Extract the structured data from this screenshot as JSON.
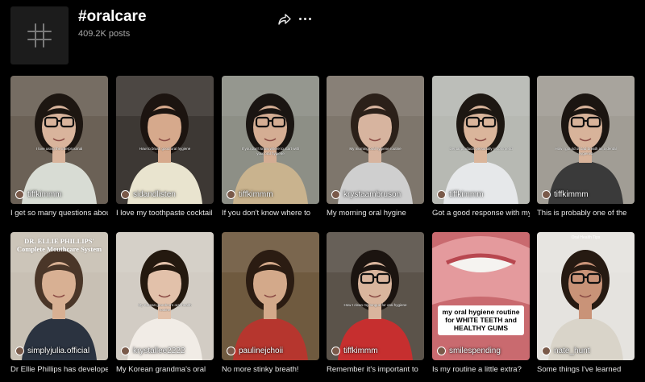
{
  "header": {
    "tag_icon": "hashtag-icon",
    "title": "#oraldcare",
    "posts": "409.2K posts",
    "share_icon": "share-icon",
    "more_icon": "more-dots-icon"
  },
  "posts": [
    {
      "username": "tiffkimmm",
      "caption": "I get so many questions about",
      "overlay": "I love using the\ninterproximal",
      "bg": "#6b6156",
      "skin": "#d9b49c",
      "hair": "#1d1611",
      "shirt": "#d8dcd4",
      "glasses": true
    },
    {
      "username": "sidandlisten",
      "caption": "I love my toothpaste cocktail",
      "overlay": "How to brush good\noral hygiene",
      "bg": "#3d3834",
      "skin": "#d6a98c",
      "hair": "#1c1410",
      "shirt": "#e9e4cf",
      "glasses": false
    },
    {
      "username": "tiffkimmm",
      "caption": "If you don't know where to",
      "overlay": "If you don't know where to\nstart with your oral hygiene",
      "bg": "#8d8f86",
      "skin": "#d4ad93",
      "hair": "#1a1512",
      "shirt": "#c9b38e",
      "glasses": true
    },
    {
      "username": "krystaambruson",
      "caption": "My morning oral hygine",
      "overlay": "My morning oral hygiene\nroutine",
      "bg": "#7e766c",
      "skin": "#d7b49f",
      "hair": "#2b2019",
      "shirt": "#cfcfcf",
      "glasses": false
    },
    {
      "username": "tiffkimmm",
      "caption": "Got a good response with my",
      "overlay": "Dental products\npersonally recommend",
      "bg": "#b7b9b3",
      "skin": "#dab59b",
      "hair": "#1d1712",
      "shirt": "#e6e8ea",
      "glasses": true
    },
    {
      "username": "tiffkimmm",
      "caption": "This is probably one of the",
      "overlay": "How I got rid of bad breath\nas a dental hygienist",
      "bg": "#a19d95",
      "skin": "#d8b39a",
      "hair": "#1b1511",
      "shirt": "#3a3a3a",
      "glasses": true
    },
    {
      "username": "simplyjulia.official",
      "caption": "Dr Ellie Phillips has developed",
      "overlay": "DR. ELLIE PHILLIPS'\nComplete Mouthcare System",
      "bg": "#c8c0b4",
      "skin": "#d8b093",
      "hair": "#4a3628",
      "shirt": "#2b3340",
      "glasses": false
    },
    {
      "username": "krystallee2222",
      "caption": "My Korean grandma's oral",
      "overlay": "My Korean grandma's oral\nhealth routine",
      "bg": "#d2ccc4",
      "skin": "#e2c1aa",
      "hair": "#24190f",
      "shirt": "#f1ece6",
      "glasses": false
    },
    {
      "username": "paulinejchoii",
      "caption": "No more stinky breath!",
      "overlay": "",
      "bg": "#6f5a3f",
      "skin": "#d3a98a",
      "hair": "#2b1c12",
      "shirt": "#b6362e",
      "glasses": false
    },
    {
      "username": "tiffkimmm",
      "caption": "Remember it's important to",
      "overlay": "How I clean my tongue\nfor oral hygiene",
      "bg": "#5b534a",
      "skin": "#d9b59d",
      "hair": "#1b1410",
      "shirt": "#c62f2f",
      "glasses": true
    },
    {
      "username": "smilespending",
      "caption": "Is my routine a little extra?",
      "overlay": "my oral hygiene routine for WHITE TEETH and HEALTHY GUMS",
      "bg": "#c96a6f",
      "skin": "#e09498",
      "hair": "#f0dede",
      "shirt": "#f4f4f4",
      "glasses": false
    },
    {
      "username": "nate_hunt",
      "caption": "Some things I've learned",
      "overlay": "Oral Health Tips",
      "bg": "#e5e3df",
      "skin": "#c99378",
      "hair": "#261a12",
      "shirt": "#d9d4c9",
      "glasses": true
    }
  ]
}
